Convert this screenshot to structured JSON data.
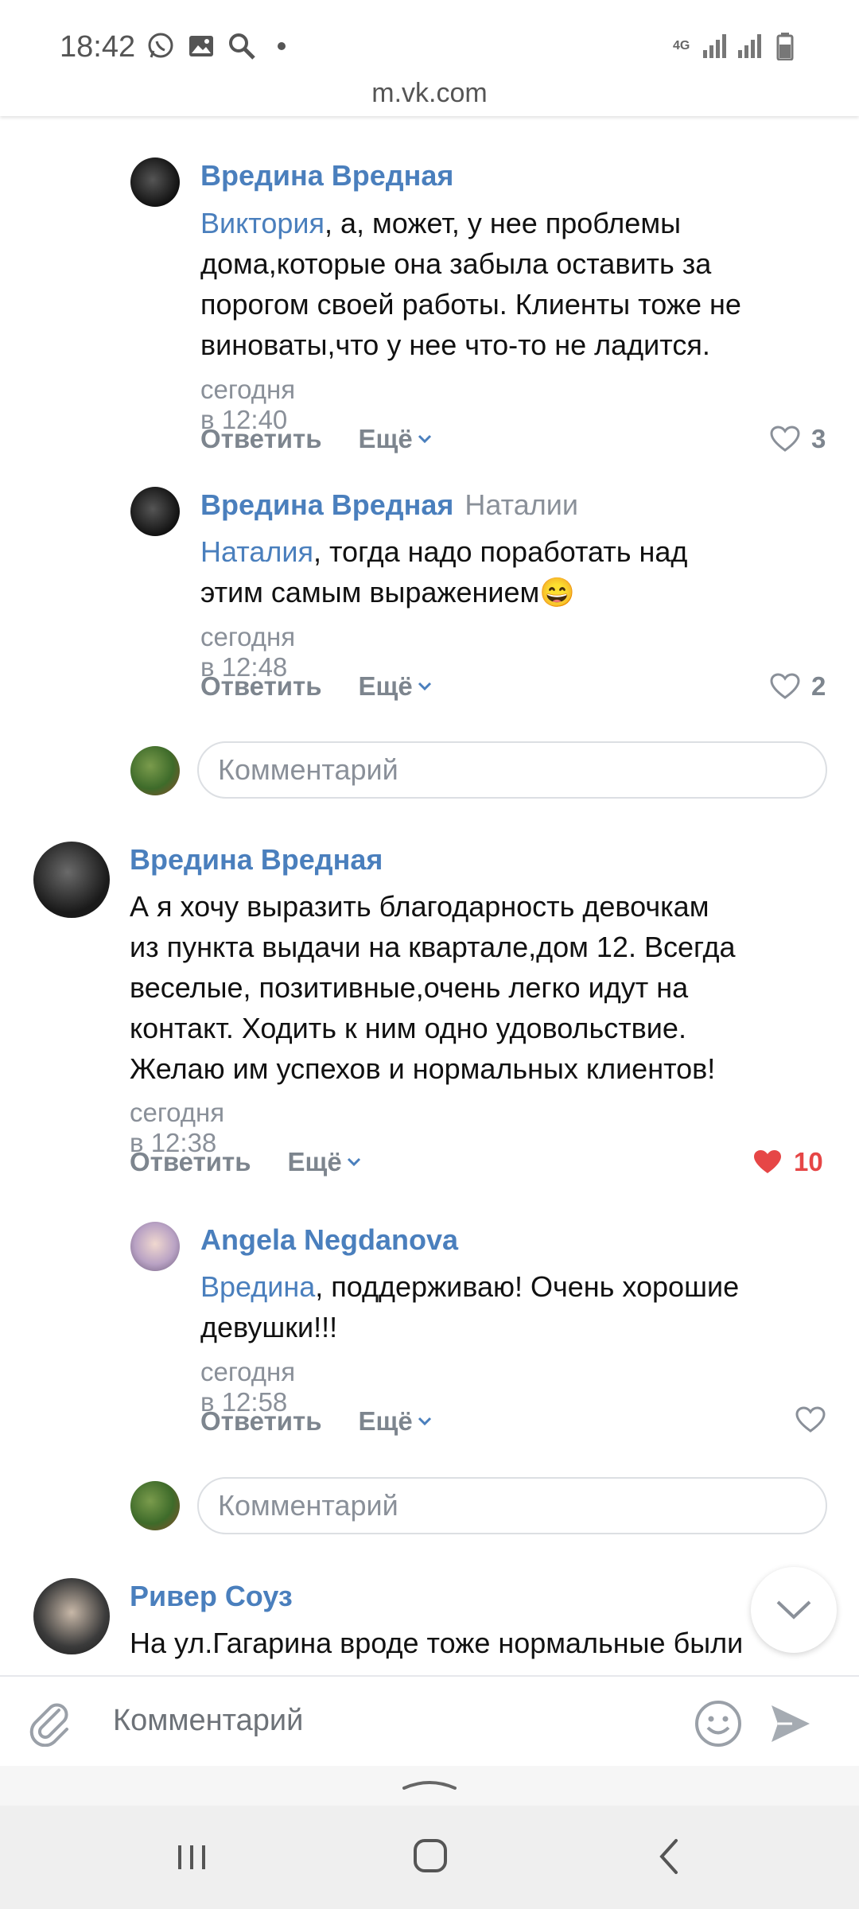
{
  "status_bar": {
    "time": "18:42",
    "network": "4G"
  },
  "browser": {
    "url": "m.vk.com"
  },
  "comments": [
    {
      "author": "Вредина Вредная",
      "mention": "Виктория",
      "text_lines": [
        ", а, может, у нее проблемы",
        "дома,которые она забыла оставить за",
        "порогом своей работы. Клиенты тоже не",
        "виноваты,что у нее что-то не ладится."
      ],
      "time": "сегодня в 12:40",
      "reply_label": "Ответить",
      "more_label": "Ещё",
      "likes": "3"
    },
    {
      "author": "Вредина Вредная",
      "reply_to": "Наталии",
      "mention": "Наталия",
      "text_lines": [
        ", тогда надо поработать над",
        "этим самым выражением😄"
      ],
      "time": "сегодня в 12:48",
      "reply_label": "Ответить",
      "more_label": "Ещё",
      "likes": "2"
    },
    {
      "author": "Вредина Вредная",
      "text_lines": [
        "А я хочу выразить благодарность девочкам",
        "из пункта выдачи на квартале,дом 12. Всегда",
        "веселые, позитивные,очень легко идут на",
        "контакт. Ходить к ним одно удовольствие.",
        "Желаю им успехов и нормальных клиентов!"
      ],
      "time": "сегодня в 12:38",
      "reply_label": "Ответить",
      "more_label": "Ещё",
      "likes": "10"
    },
    {
      "author": "Angela Negdanova",
      "mention": "Вредина",
      "text_lines": [
        ", поддерживаю! Очень хорошие",
        "девушки!!!"
      ],
      "time": "сегодня в 12:58",
      "reply_label": "Ответить",
      "more_label": "Ещё"
    },
    {
      "author": "Ривер Соуз",
      "text_lines": [
        "На ул.Гагарина вроде тоже нормальные были"
      ]
    }
  ],
  "reply_inputs": {
    "placeholder": "Комментарий"
  },
  "composer": {
    "placeholder": "Комментарий"
  },
  "colors": {
    "link": "#4a7fbd",
    "like_active": "#e64646",
    "muted": "#8a9099"
  },
  "icons": [
    "whatsapp-icon",
    "gallery-icon",
    "search-icon",
    "dot-icon",
    "signal-icon",
    "battery-icon",
    "heart-icon",
    "heart-filled-icon",
    "chevron-down-icon",
    "paperclip-icon",
    "smile-icon",
    "send-icon",
    "chevron-up-icon",
    "recent-apps-icon",
    "home-icon",
    "back-icon"
  ]
}
